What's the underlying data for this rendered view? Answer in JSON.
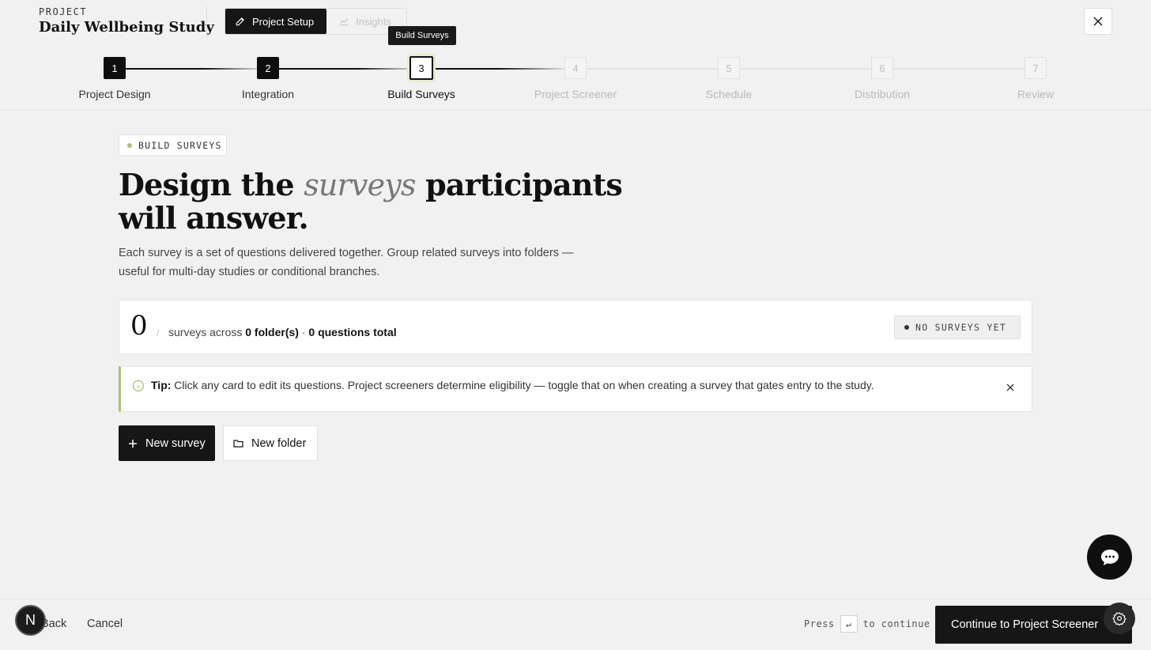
{
  "header": {
    "project_label": "PROJECT",
    "project_title": "Daily Wellbeing Study",
    "tabs": {
      "setup": "Project Setup",
      "insights": "Insights"
    },
    "tooltip": "Build Surveys"
  },
  "stepper": {
    "steps": [
      {
        "num": "1",
        "label": "Project Design",
        "state": "done"
      },
      {
        "num": "2",
        "label": "Integration",
        "state": "done"
      },
      {
        "num": "3",
        "label": "Build Surveys",
        "state": "current"
      },
      {
        "num": "4",
        "label": "Project Screener",
        "state": "future"
      },
      {
        "num": "5",
        "label": "Schedule",
        "state": "future"
      },
      {
        "num": "6",
        "label": "Distribution",
        "state": "future"
      },
      {
        "num": "7",
        "label": "Review",
        "state": "future"
      }
    ]
  },
  "main": {
    "badge": "BUILD SURVEYS",
    "headline_pre": "Design the ",
    "headline_em": "surveys",
    "headline_post": " participants will answer.",
    "subtext": "Each survey is a set of questions delivered together. Group related surveys into folders — useful for multi-day studies or conditional branches.",
    "stats": {
      "count": "0",
      "slash": "/",
      "text_pre": "surveys across ",
      "folders": "0 folder(s)",
      "sep": " · ",
      "questions": "0 questions total",
      "status": "NO SURVEYS YET"
    },
    "tip": {
      "label": "Tip:",
      "text": " Click any card to edit its questions. Project screeners determine eligibility — toggle that on when creating a survey that gates entry to the study."
    },
    "buttons": {
      "new_survey": "New survey",
      "new_folder": "New folder"
    }
  },
  "footer": {
    "avatar_letter": "N",
    "back": "Back",
    "cancel": "Cancel",
    "press": "Press",
    "key": "↵",
    "to_continue": "to continue",
    "continue": "Continue to Project Screener"
  },
  "colors": {
    "accent": "#a9c46a",
    "dark": "#161616",
    "background": "#f1f1f1"
  }
}
